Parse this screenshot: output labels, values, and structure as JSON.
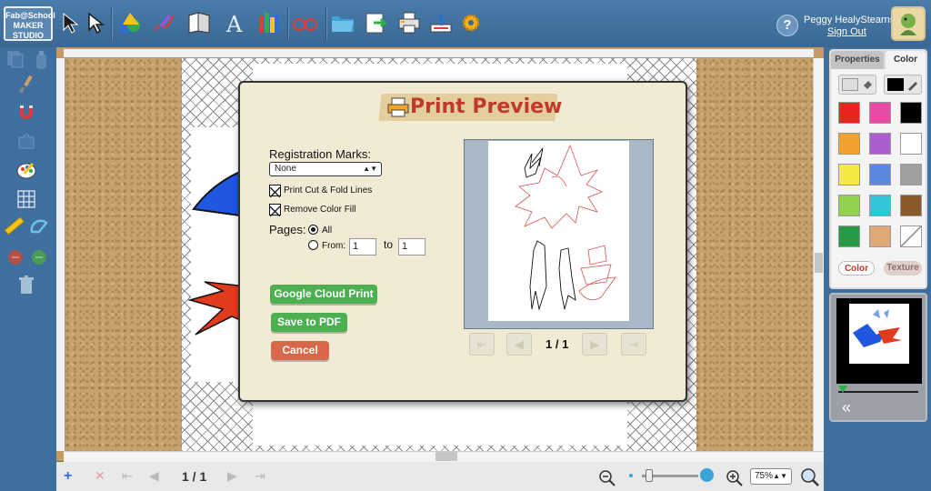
{
  "header": {
    "logo_text": "Fab@School MAKER STUDIO",
    "user_name": "Peggy HealyStearns",
    "sign_out": "Sign Out",
    "help": "?"
  },
  "bottom": {
    "page_indicator": "1 / 1",
    "zoom": "75%"
  },
  "right_panel": {
    "tabs": [
      "Properties",
      "Color"
    ],
    "pills": [
      "Color",
      "Texture"
    ],
    "swatches": [
      "#e8261d",
      "#e94aa6",
      "#000000",
      "#f2a02f",
      "#ab5fce",
      "#ffffff",
      "#f5e942",
      "#5b87e0",
      "#a0a0a0",
      "#93d24d",
      "#2fc7d5",
      "#8b5a2b",
      "#279a45",
      "#e0a878",
      "none"
    ]
  },
  "dialog": {
    "title": "Print Preview",
    "registration_label": "Registration Marks:",
    "registration_value": "None",
    "print_cut_fold": "Print Cut & Fold Lines",
    "remove_color_fill": "Remove Color Fill",
    "pages_label": "Pages:",
    "all_label": "All",
    "from_label": "From:",
    "to_label": "to",
    "from_value": "1",
    "to_value": "1",
    "google_cloud_print": "Google Cloud Print",
    "save_to_pdf": "Save to PDF",
    "cancel": "Cancel",
    "preview_page": "1 / 1"
  }
}
